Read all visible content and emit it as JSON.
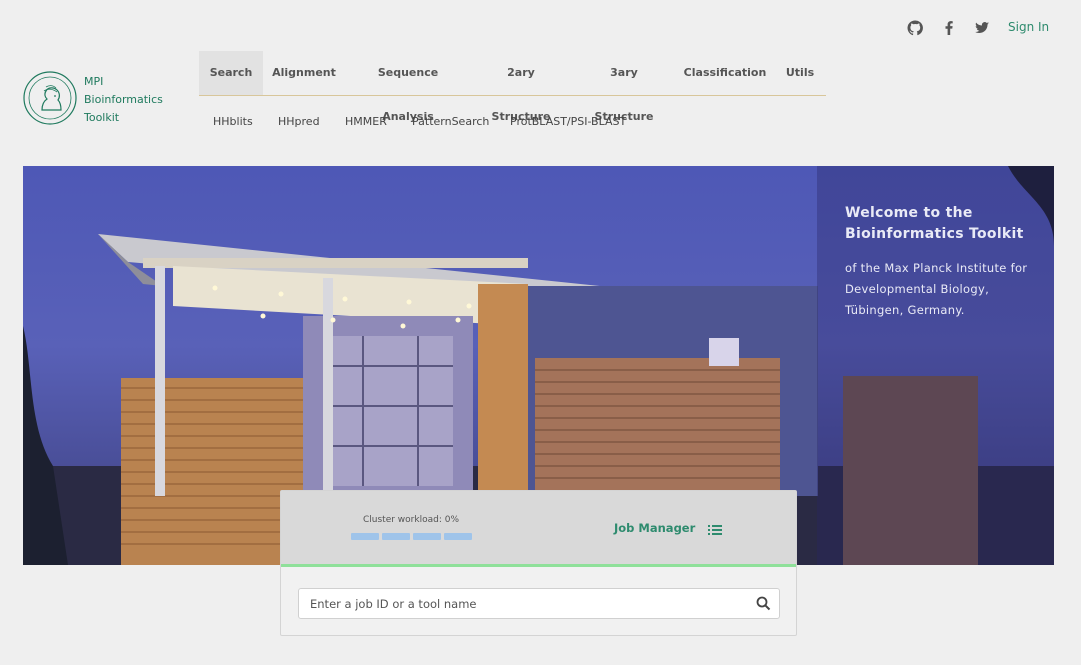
{
  "header": {
    "icons": [
      "github-icon",
      "facebook-icon",
      "twitter-icon"
    ],
    "sign_in": "Sign In"
  },
  "logo": {
    "line1": "MPI",
    "line2": "Bioinformatics",
    "line3": "Toolkit"
  },
  "nav": {
    "tabs": [
      {
        "label": "Search",
        "active": true
      },
      {
        "label": "Alignment"
      },
      {
        "label": "Sequence Analysis"
      },
      {
        "label": "2ary Structure"
      },
      {
        "label": "3ary Structure"
      },
      {
        "label": "Classification"
      },
      {
        "label": "Utils"
      }
    ],
    "subtabs": [
      "HHblits",
      "HHpred",
      "HMMER",
      "PatternSearch",
      "ProtBLAST/PSI-BLAST"
    ]
  },
  "hero": {
    "title": "Welcome to the Bioinformatics Toolkit",
    "subtitle": "of the Max Planck Institute for Developmental Biology, Tübingen, Germany."
  },
  "job_manager": {
    "workload_label": "Cluster workload: 0%",
    "workload_value": 0,
    "label": "Job Manager"
  },
  "search": {
    "placeholder": "Enter a job ID or a tool name"
  },
  "colors": {
    "accent": "#2e8b6e",
    "nav_underline": "#d8c69a",
    "progress_line": "#8fe09a"
  }
}
